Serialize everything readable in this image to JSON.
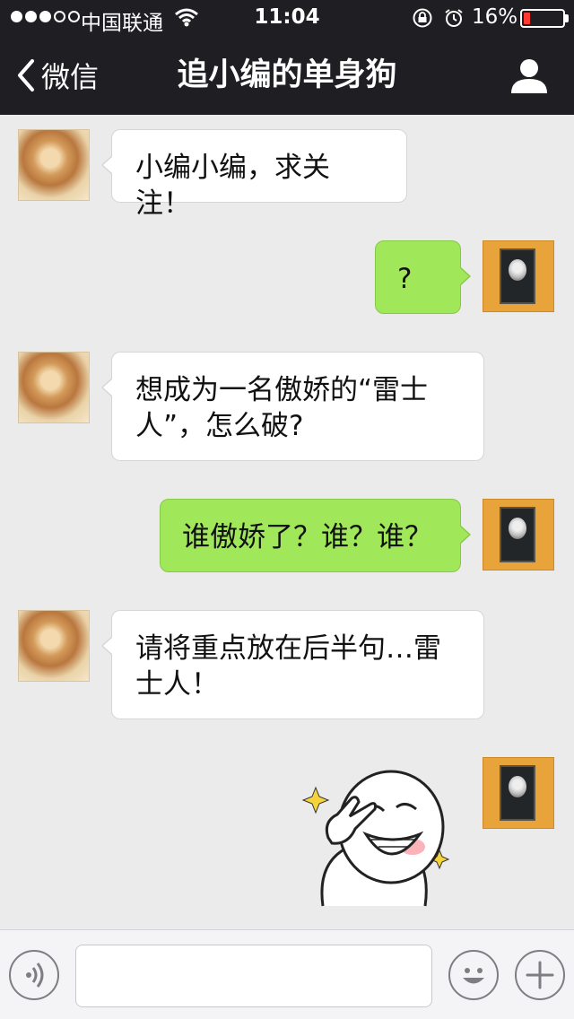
{
  "status_bar": {
    "carrier": "中国联通",
    "time": "11:04",
    "battery_percent_label": "16%",
    "battery_level": 0.16,
    "signal_bars_filled": 3,
    "signal_bars_total": 5
  },
  "nav": {
    "back_label": "微信",
    "title": "追小编的单身狗",
    "icons": {
      "back": "chevron-left-icon",
      "profile": "person-icon"
    }
  },
  "messages": [
    {
      "sender": "other",
      "text": "小编小编，求关注！"
    },
    {
      "sender": "me",
      "text": "?"
    },
    {
      "sender": "other",
      "text": "想成为一名傲娇的“雷士人”，怎么破?"
    },
    {
      "sender": "me",
      "text": "谁傲娇了？谁？谁？"
    },
    {
      "sender": "other",
      "text": "请将重点放在后半句…雷士人！"
    },
    {
      "sender": "me",
      "type": "sticker",
      "sticker": "rage-face-peace-sticker"
    }
  ],
  "input_bar": {
    "placeholder": "",
    "icons": {
      "voice": "voice-icon",
      "emoji": "emoji-icon",
      "plus": "plus-icon"
    }
  },
  "colors": {
    "nav_background": "#1f1f23",
    "chat_background": "#ebebeb",
    "outgoing_bubble": "#a0e75a",
    "incoming_bubble": "#ffffff",
    "battery_low": "#ff3b30"
  }
}
